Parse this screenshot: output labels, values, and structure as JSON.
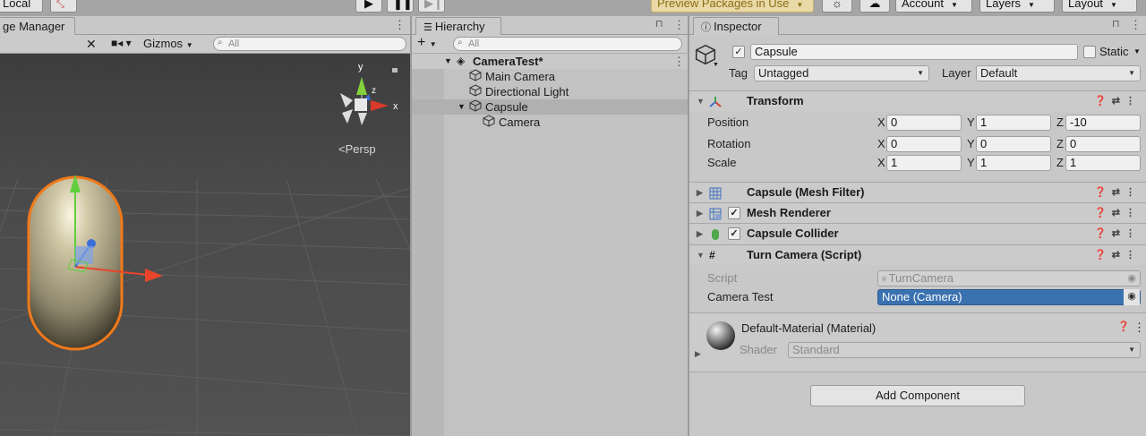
{
  "toolbar": {
    "pivot_label": "Local",
    "preview_label": "Preview Packages in Use",
    "account_label": "Account",
    "layers_label": "Layers",
    "layout_label": "Layout"
  },
  "scene": {
    "tab_label": "ge Manager",
    "gizmos_label": "Gizmos",
    "search_placeholder": "All",
    "persp_label": "Persp",
    "axis_y": "y",
    "axis_x": "x",
    "axis_z": "z"
  },
  "hierarchy": {
    "tab_label": "Hierarchy",
    "search_placeholder": "All",
    "items": [
      {
        "label": "CameraTest*"
      },
      {
        "label": "Main Camera"
      },
      {
        "label": "Directional Light"
      },
      {
        "label": "Capsule"
      },
      {
        "label": "Camera"
      }
    ]
  },
  "inspector": {
    "tab_label": "Inspector",
    "object_name": "Capsule",
    "static_label": "Static",
    "tag_label": "Tag",
    "tag_value": "Untagged",
    "layer_label": "Layer",
    "layer_value": "Default",
    "transform": {
      "title": "Transform",
      "rows": [
        {
          "label": "Position",
          "x": "0",
          "y": "1",
          "z": "-10"
        },
        {
          "label": "Rotation",
          "x": "0",
          "y": "0",
          "z": "0"
        },
        {
          "label": "Scale",
          "x": "1",
          "y": "1",
          "z": "1"
        }
      ],
      "axis_x": "X",
      "axis_y": "Y",
      "axis_z": "Z"
    },
    "mesh_filter_title": "Capsule (Mesh Filter)",
    "mesh_renderer_title": "Mesh Renderer",
    "capsule_collider_title": "Capsule Collider",
    "script_component": {
      "title": "Turn Camera (Script)",
      "script_label": "Script",
      "script_value": "TurnCamera",
      "camera_test_label": "Camera Test",
      "camera_test_value": "None (Camera)"
    },
    "material": {
      "title": "Default-Material (Material)",
      "shader_label": "Shader",
      "shader_value": "Standard"
    },
    "add_component_label": "Add Component"
  },
  "colors": {
    "selection_blue": "#3a72b0",
    "capsule_outline": "#f07a1a",
    "scene_bg": "#464646"
  }
}
